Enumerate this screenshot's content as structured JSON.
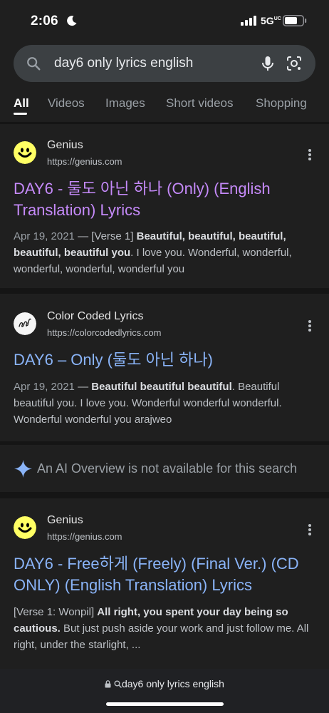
{
  "status": {
    "time": "2:06",
    "network": "5G",
    "network_sup": "UC"
  },
  "search": {
    "query": "day6 only lyrics english",
    "icon": "search-icon"
  },
  "tabs": [
    {
      "label": "All",
      "active": true
    },
    {
      "label": "Videos"
    },
    {
      "label": "Images"
    },
    {
      "label": "Short videos"
    },
    {
      "label": "Shopping"
    }
  ],
  "results": [
    {
      "site": "Genius",
      "url": "https://genius.com",
      "title": "DAY6 - 둘도 아닌 하나 (Only) (English Translation) Lyrics",
      "visited": true,
      "date": "Apr 19, 2021",
      "separator": " — ",
      "snippet_pre": "[Verse 1] ",
      "snippet_bold": "Beautiful, beautiful, beautiful, beautiful, beautiful you",
      "snippet_post": ". I love you. Wonderful, wonderful, wonderful, wonderful, wonderful you"
    },
    {
      "site": "Color Coded Lyrics",
      "url": "https://colorcodedlyrics.com",
      "title": "DAY6 – Only (둘도 아닌 하나)",
      "visited": false,
      "date": "Apr 19, 2021",
      "separator": " — ",
      "snippet_pre": "",
      "snippet_bold": "Beautiful beautiful beautiful",
      "snippet_post": ". Beautiful beautiful you. I love you. Wonderful wonderful wonderful. Wonderful wonderful you arajweo"
    },
    {
      "site": "Genius",
      "url": "https://genius.com",
      "title": "DAY6 - Free하게 (Freely) (Final Ver.) (CD ONLY) (English Translation) Lyrics",
      "visited": false,
      "snippet_pre": "[Verse 1: Wonpil] ",
      "snippet_bold": "All right, you spent your day being so cautious.",
      "snippet_post": " But just push aside your work and just follow me. All right, under the starlight, ..."
    }
  ],
  "ai_overview": {
    "text": "An AI Overview is not available for this search",
    "icon": "sparkle-icon"
  },
  "bottom_bar": {
    "url_text": "day6 only lyrics english"
  },
  "colors": {
    "background": "#1f1f1f",
    "visited_link": "#c58af9",
    "link": "#8ab4f8",
    "sparkle": "#8ab4f8"
  }
}
